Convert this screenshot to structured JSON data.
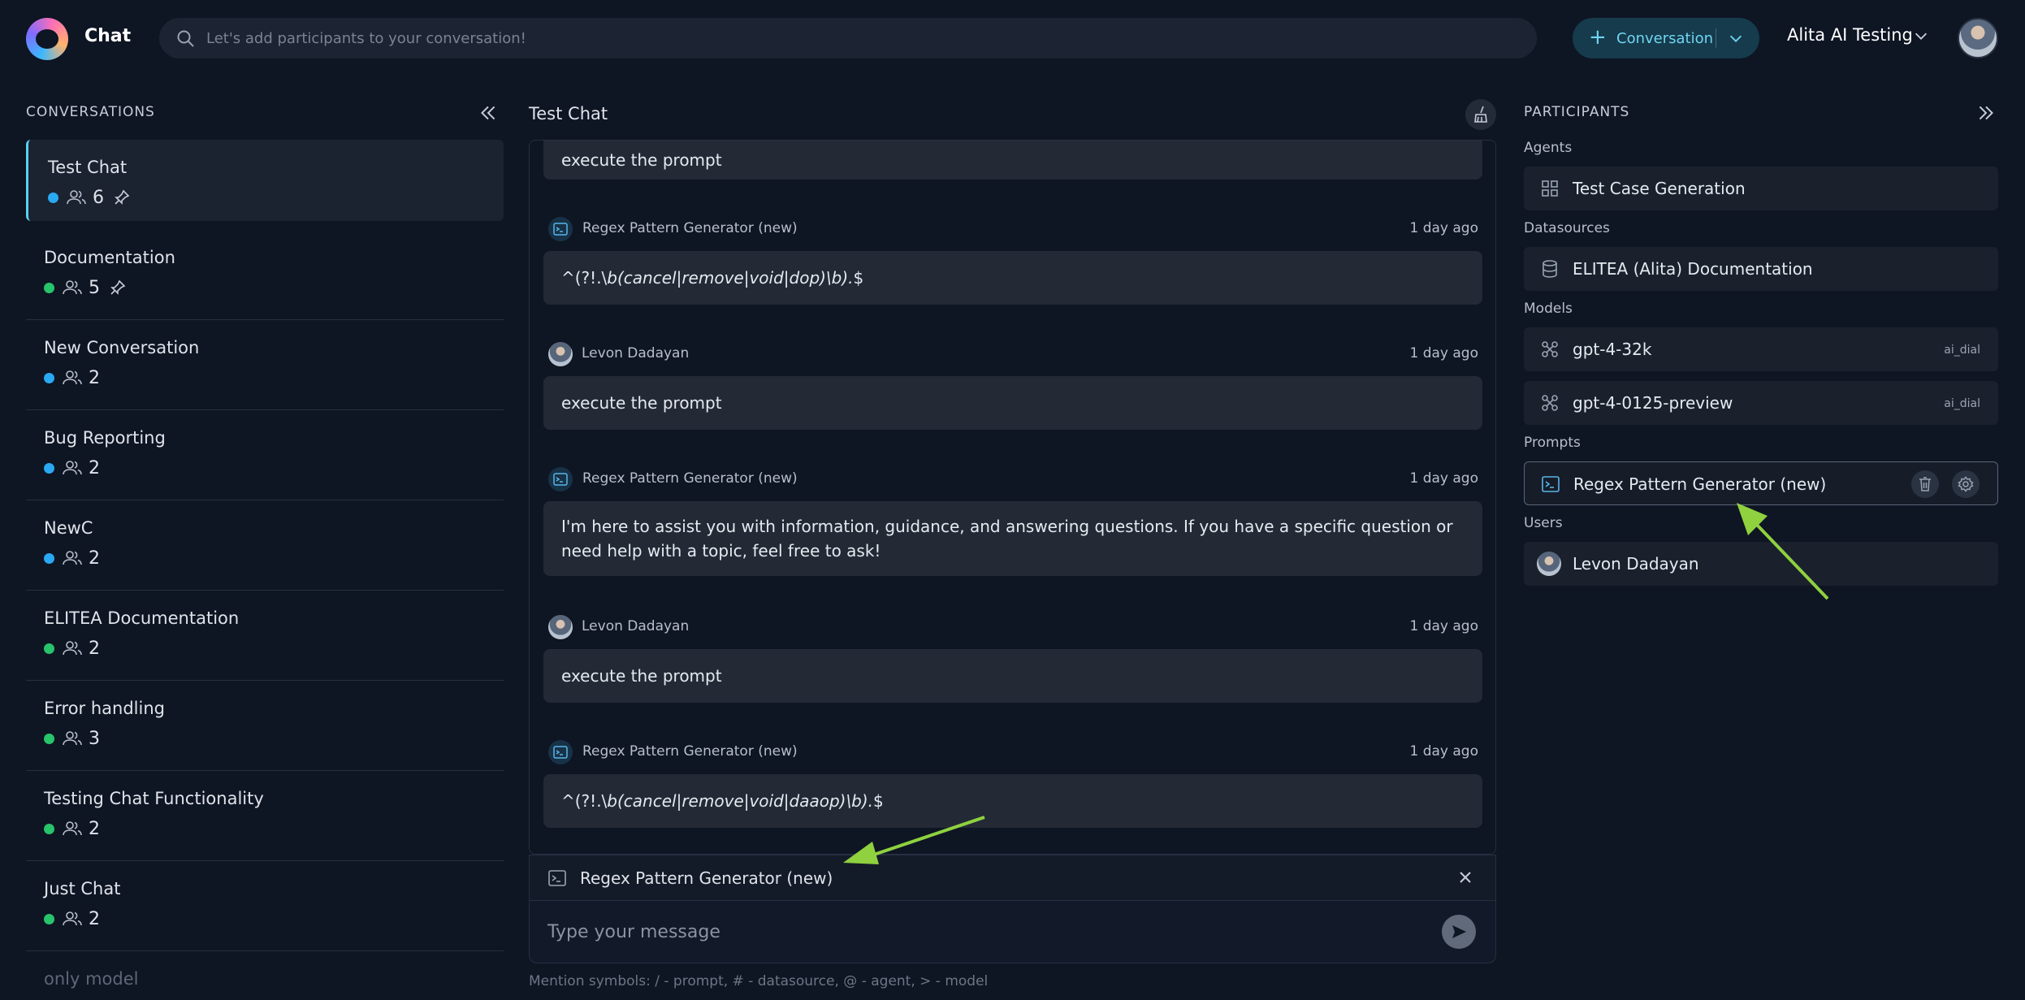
{
  "header": {
    "app_title": "Chat",
    "search_placeholder": "Let's add participants to your conversation!",
    "conversation_button": "Conversation",
    "project_name": "Alita AI Testing"
  },
  "sidebar": {
    "title": "CONVERSATIONS",
    "conversations": [
      {
        "name": "Test Chat",
        "status_color": "#2aa8f2",
        "count": "6",
        "pinned": true,
        "active": true
      },
      {
        "name": "Documentation",
        "status_color": "#27c46b",
        "count": "5",
        "pinned": true
      },
      {
        "name": "New Conversation",
        "status_color": "#2aa8f2",
        "count": "2"
      },
      {
        "name": "Bug Reporting",
        "status_color": "#2aa8f2",
        "count": "2"
      },
      {
        "name": "NewC",
        "status_color": "#2aa8f2",
        "count": "2"
      },
      {
        "name": "ELITEA Documentation",
        "status_color": "#27c46b",
        "count": "2"
      },
      {
        "name": "Error handling",
        "status_color": "#27c46b",
        "count": "3"
      },
      {
        "name": "Testing Chat Functionality",
        "status_color": "#27c46b",
        "count": "2"
      },
      {
        "name": "Just Chat",
        "status_color": "#27c46b",
        "count": "2"
      },
      {
        "name": "only model"
      }
    ]
  },
  "chat": {
    "title": "Test Chat",
    "messages": [
      {
        "text": "execute the prompt"
      },
      {
        "author": "Regex Pattern Generator (new)",
        "time": "1 day ago",
        "text_prefix": "^(?!.\\",
        "text_italic": "b(cancel|remove|void|dop)\\b).",
        "text_suffix": "$"
      },
      {
        "author": "Levon Dadayan",
        "time": "1 day ago",
        "text": "execute the prompt"
      },
      {
        "author": "Regex Pattern Generator (new)",
        "time": "1 day ago",
        "text": "I'm here to assist you with information, guidance, and answering questions. If you have a specific question or need help with a topic, feel free to ask!"
      },
      {
        "author": "Levon Dadayan",
        "time": "1 day ago",
        "text": "execute the prompt"
      },
      {
        "author": "Regex Pattern Generator (new)",
        "time": "1 day ago",
        "text_prefix": "^(?!.\\",
        "text_italic": "b(cancel|remove|void|daaop)\\b).",
        "text_suffix": "$"
      }
    ],
    "attached_prompt": "Regex Pattern Generator (new)",
    "input_placeholder": "Type your message",
    "hint": "Mention symbols: / - prompt, # - datasource, @ - agent, > - model"
  },
  "participants": {
    "title": "PARTICIPANTS",
    "agents_label": "Agents",
    "agents": [
      "Test Case Generation"
    ],
    "datasources_label": "Datasources",
    "datasources": [
      "ELITEA (Alita) Documentation"
    ],
    "models_label": "Models",
    "models": [
      {
        "name": "gpt-4-32k",
        "provider": "ai_dial"
      },
      {
        "name": "gpt-4-0125-preview",
        "provider": "ai_dial"
      }
    ],
    "prompts_label": "Prompts",
    "prompts": [
      "Regex Pattern Generator (new)"
    ],
    "users_label": "Users",
    "users": [
      "Levon Dadayan"
    ]
  },
  "annotation_color": "#8fd13f"
}
